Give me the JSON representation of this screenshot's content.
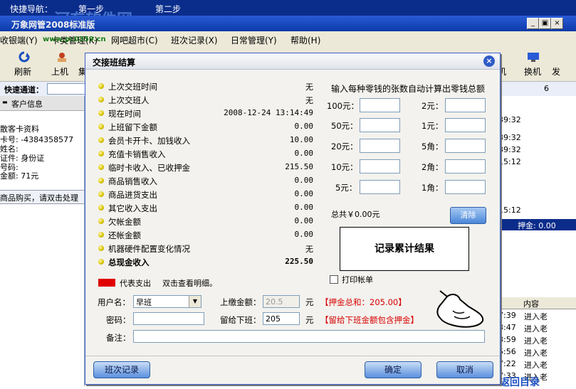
{
  "topnav": {
    "label": "快捷导航：",
    "step1": "第一步",
    "step2": "第二步",
    "watermark": "河东软件网",
    "watermark2": "www.pc0359.cn"
  },
  "app": {
    "title": "万象网管2008标准版",
    "minimize": "_",
    "restore": "▣",
    "close": "×"
  },
  "menu": [
    "收银端(Y)",
    "卡类管理(K)",
    "网吧超市(C)",
    "班次记录(X)",
    "日常管理(Y)",
    "帮助(H)"
  ],
  "toolbar": {
    "refresh": "刷新",
    "online": "上机",
    "switch": "换机",
    "partial_left": "集",
    "partial_mid": "机",
    "partial_right": "发"
  },
  "quick": {
    "label": "快速通道：",
    "right_value": "6"
  },
  "left_panel": {
    "header": "客户信息",
    "lines": [
      "散客卡资料",
      "卡号: -4384358577",
      "姓名:",
      "证件: 身份证",
      "号码:",
      "金额: 71元"
    ],
    "hint": "商品购买，请双击处理"
  },
  "right_panel": {
    "times": [
      "39:32",
      "39:32",
      "39:32",
      "15:12",
      "15:12"
    ],
    "deposit": "押金: 0.00",
    "header": "内容",
    "log_times": [
      "7:39",
      "3:47",
      "3:59",
      "5:56",
      "7:22",
      "7:33"
    ],
    "log_content": [
      "进入老",
      "进入老",
      "进入老",
      "进入老",
      "进入老",
      "进入老"
    ],
    "bottom": "返回目录"
  },
  "dialog": {
    "title": "交接班结算",
    "close": "×",
    "rows": [
      {
        "label": "上次交班时间",
        "value": "无"
      },
      {
        "label": "上次交班人",
        "value": "无"
      },
      {
        "label": "现在时间",
        "value": "2008-12-24 13:14:49"
      },
      {
        "label": "上班留下金额",
        "value": "0.00"
      },
      {
        "label": "会员卡开卡、加钱收入",
        "value": "10.00"
      },
      {
        "label": "充值卡销售收入",
        "value": "0.00"
      },
      {
        "label": "临时卡收入、已收押金",
        "value": "215.50"
      },
      {
        "label": "商品销售收入",
        "value": "0.00"
      },
      {
        "label": "商品进货支出",
        "value": "0.00"
      },
      {
        "label": "其它收入支出",
        "value": "0.00"
      },
      {
        "label": "欠帐金额",
        "value": "0.00"
      },
      {
        "label": "还帐金额",
        "value": "0.00"
      },
      {
        "label": "机器硬件配置变化情况",
        "value": "无"
      },
      {
        "label": "总现金收入",
        "value": "225.50"
      }
    ],
    "legend": {
      "text": "代表支出",
      "hint": "双击查看明细。"
    },
    "change_title": "输入每种零钱的张数自动计算出零钱总额",
    "denoms_left": [
      "100元：",
      "50元：",
      "20元：",
      "10元：",
      "5元："
    ],
    "denoms_right": [
      "2元：",
      "1元：",
      "5角：",
      "2角：",
      "1角："
    ],
    "total": "总共￥0.00元",
    "clear": "清除",
    "result": "记录累计结果",
    "print": "打印帐单",
    "user_label": "用户名：",
    "user_value": "早班",
    "password_label": "密码：",
    "note_label": "备注：",
    "paid_label": "上缴金额：",
    "paid_value": "20.5",
    "leave_label": "留给下班：",
    "leave_value": "205",
    "yuan": "元",
    "deposit_total": "【押金总和：205.00】",
    "leave_note": "【留给下班金额包含押金】",
    "history_button": "班次记录",
    "ok_button": "确定",
    "cancel_button": "取消"
  },
  "colors": {
    "title_blue": "#0c3aa8",
    "expense_red": "#e00000",
    "warn_red": "#d60000"
  }
}
